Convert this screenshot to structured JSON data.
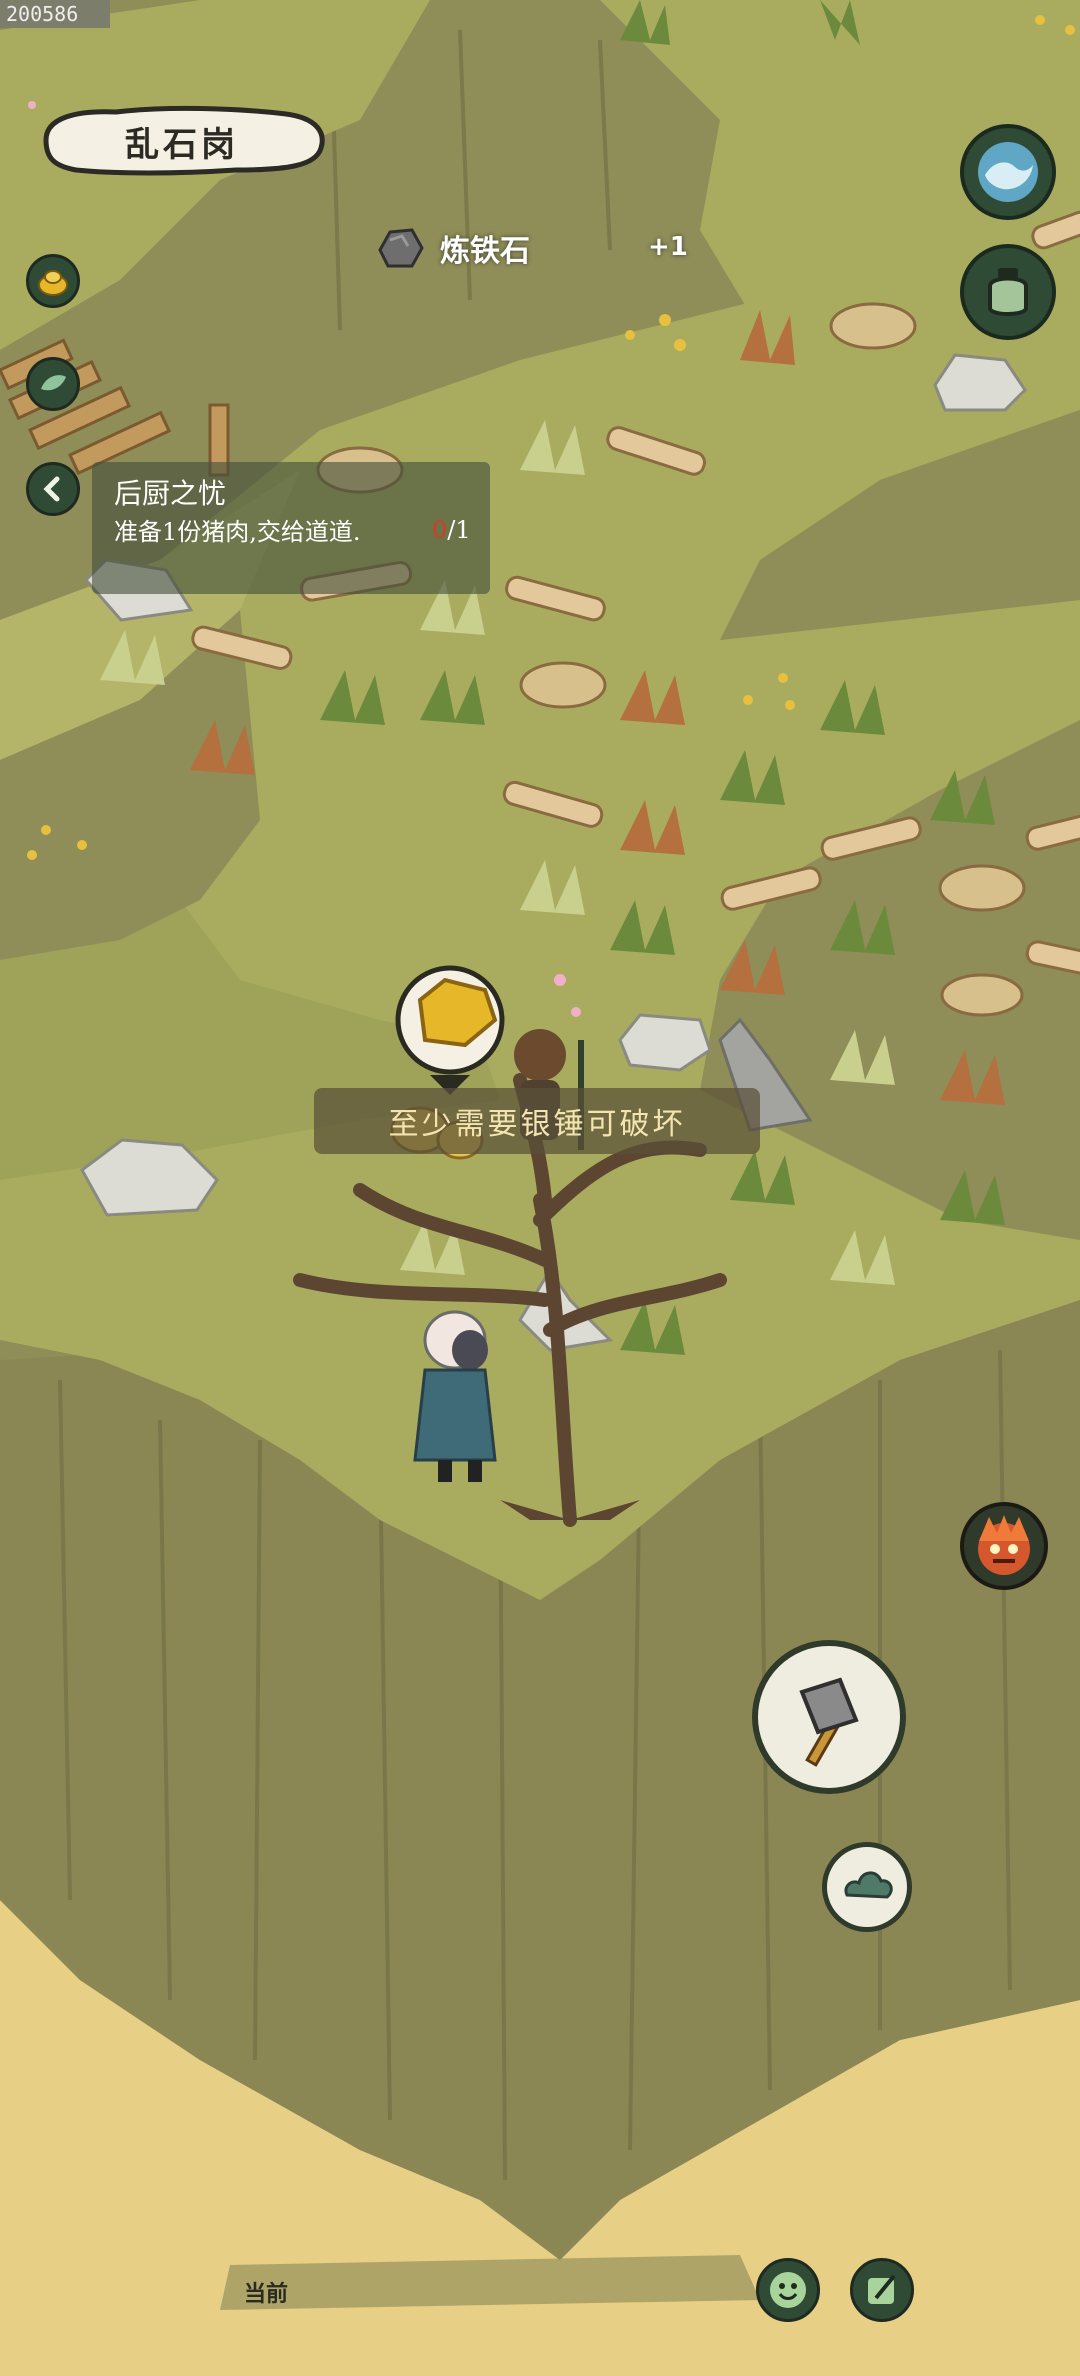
{
  "build": {
    "id": "200586"
  },
  "location": {
    "name": "乱石岗"
  },
  "item_toast": {
    "name": "炼铁石",
    "count": "+1",
    "icon": "iron-ore-icon"
  },
  "quest": {
    "title": "后厨之忧",
    "description": "准备1份猪肉,交给道道.",
    "progress_current": "0",
    "progress_total": "/1"
  },
  "hint": {
    "text": "至少需要银锤可破坏"
  },
  "bottom_bar": {
    "current_label": "当前"
  },
  "icons": {
    "left": [
      "gold-ingot-icon",
      "leaf-icon",
      "collapse-arrow-icon"
    ],
    "right_top": [
      "water-wave-icon",
      "jar-icon"
    ],
    "right": [
      "demon-face-icon",
      "hammer-icon",
      "cloud-icon"
    ],
    "bottom": [
      "smile-face-icon",
      "brush-icon"
    ]
  },
  "colors": {
    "grass": "#a9ac5e",
    "cliff": "#8f8d58",
    "sand": "#e8cf86",
    "dark_green": "#2f4a35",
    "accent_red": "#d83a2a"
  }
}
